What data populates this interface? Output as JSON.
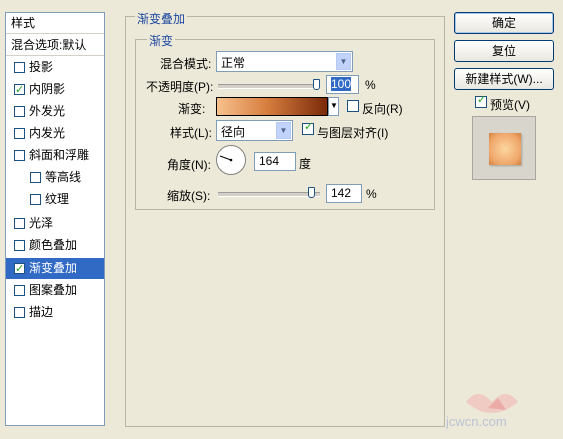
{
  "list": {
    "header": "样式",
    "blend_options": "混合选项:默认",
    "items": [
      {
        "label": "投影",
        "checked": false
      },
      {
        "label": "内阴影",
        "checked": true
      },
      {
        "label": "外发光",
        "checked": false
      },
      {
        "label": "内发光",
        "checked": false
      },
      {
        "label": "斜面和浮雕",
        "checked": false
      },
      {
        "label": "等高线",
        "checked": false
      },
      {
        "label": "纹理",
        "checked": false
      },
      {
        "label": "光泽",
        "checked": false
      },
      {
        "label": "颜色叠加",
        "checked": false
      },
      {
        "label": "渐变叠加",
        "checked": true
      },
      {
        "label": "图案叠加",
        "checked": false
      },
      {
        "label": "描边",
        "checked": false
      }
    ]
  },
  "panel": {
    "group_title": "渐变叠加",
    "sub_title": "渐变",
    "blend_mode_label": "混合模式:",
    "blend_mode_value": "正常",
    "opacity_label": "不透明度(P):",
    "opacity_value": "100",
    "opacity_unit": "%",
    "opacity_level": 1.0,
    "gradient_label": "渐变:",
    "reverse_label": "反向(R)",
    "reverse_checked": false,
    "style_label": "样式(L):",
    "style_value": "径向",
    "align_label": "与图层对齐(I)",
    "align_checked": true,
    "angle_label": "角度(N):",
    "angle_value": "164",
    "angle_unit": "度",
    "scale_label": "缩放(S):",
    "scale_value": "142",
    "scale_unit": "%",
    "scale_level": 0.95
  },
  "buttons": {
    "ok": "确定",
    "reset": "复位",
    "new_style": "新建样式(W)...",
    "preview_label": "预览(V)",
    "preview_checked": true
  },
  "colors": {
    "selection": "#316ac5",
    "title_blue": "#1c48a2",
    "check_green": "#21a121",
    "gradient_start": "#f7c18d",
    "gradient_end": "#7a2a0a"
  },
  "watermark": "jcwcn.com"
}
